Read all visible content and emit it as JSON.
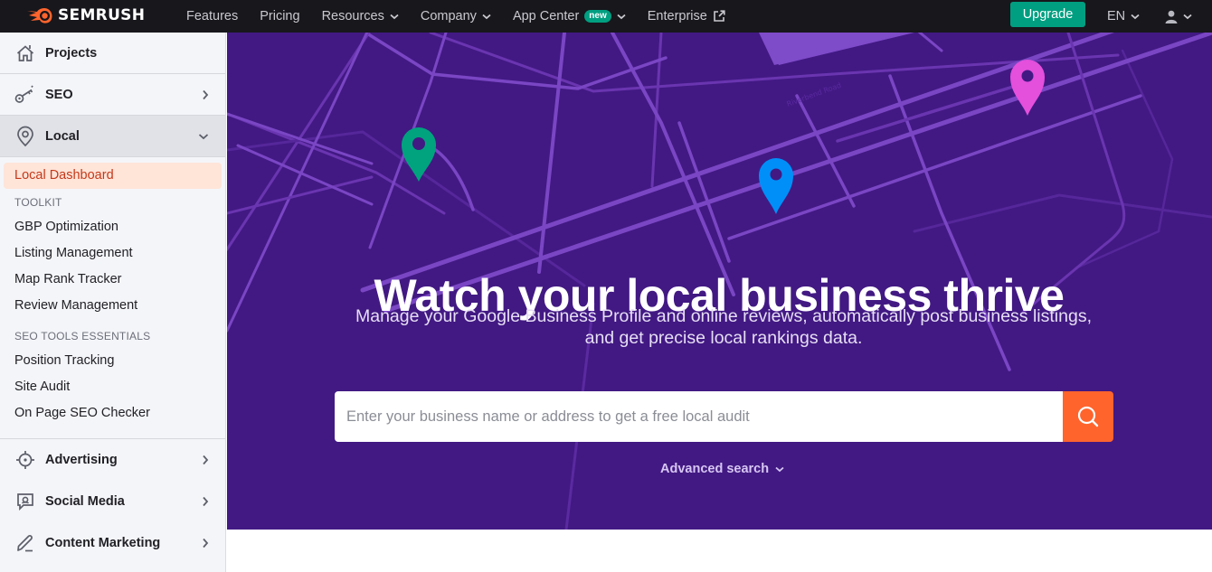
{
  "topbar": {
    "brand": "SEMRUSH",
    "nav": [
      {
        "label": "Features",
        "has_dropdown": false
      },
      {
        "label": "Pricing",
        "has_dropdown": false
      },
      {
        "label": "Resources",
        "has_dropdown": true
      },
      {
        "label": "Company",
        "has_dropdown": true
      },
      {
        "label": "App Center",
        "has_dropdown": true,
        "badge": "new"
      },
      {
        "label": "Enterprise",
        "external": true
      }
    ],
    "upgrade_label": "Upgrade",
    "language": "EN",
    "user_icon": "user-icon"
  },
  "sidebar": {
    "main_items": [
      {
        "label": "Projects",
        "icon": "home-icon"
      },
      {
        "label": "SEO",
        "icon": "key-icon"
      },
      {
        "label": "Local",
        "icon": "location-pin-icon",
        "expanded": true
      }
    ],
    "local_current": "Local Dashboard",
    "toolkit_heading": "TOOLKIT",
    "toolkit": [
      "GBP Optimization",
      "Listing Management",
      "Map Rank Tracker",
      "Review Management"
    ],
    "essentials_heading": "SEO TOOLS ESSENTIALS",
    "essentials": [
      "Position Tracking",
      "Site Audit",
      "On Page SEO Checker"
    ],
    "bottom_items": [
      {
        "label": "Advertising",
        "icon": "crosshair-icon"
      },
      {
        "label": "Social Media",
        "icon": "chat-bubble-icon"
      },
      {
        "label": "Content Marketing",
        "icon": "pencil-icon"
      }
    ]
  },
  "hero": {
    "title": "Watch your local business thrive",
    "subtitle": "Manage your Google Business Profile and online reviews, automatically post business listings, and get precise local rankings data.",
    "search_placeholder": "Enter your business name or address to get a free local audit",
    "search_value": "",
    "advanced_search_label": "Advanced search",
    "map_street_label": "Riverbend Road",
    "pin_colors": {
      "green": "#00a37e",
      "blue": "#008ff8",
      "pink": "#e44fdc"
    }
  },
  "colors": {
    "topbar_bg": "#17171c",
    "hero_bg": "#421983",
    "map_lines": "#7a46c4",
    "accent_orange": "#ff642d",
    "upgrade_green": "#009f81",
    "active_link_bg": "#ffe4d8",
    "active_link_text": "#c4391a"
  }
}
